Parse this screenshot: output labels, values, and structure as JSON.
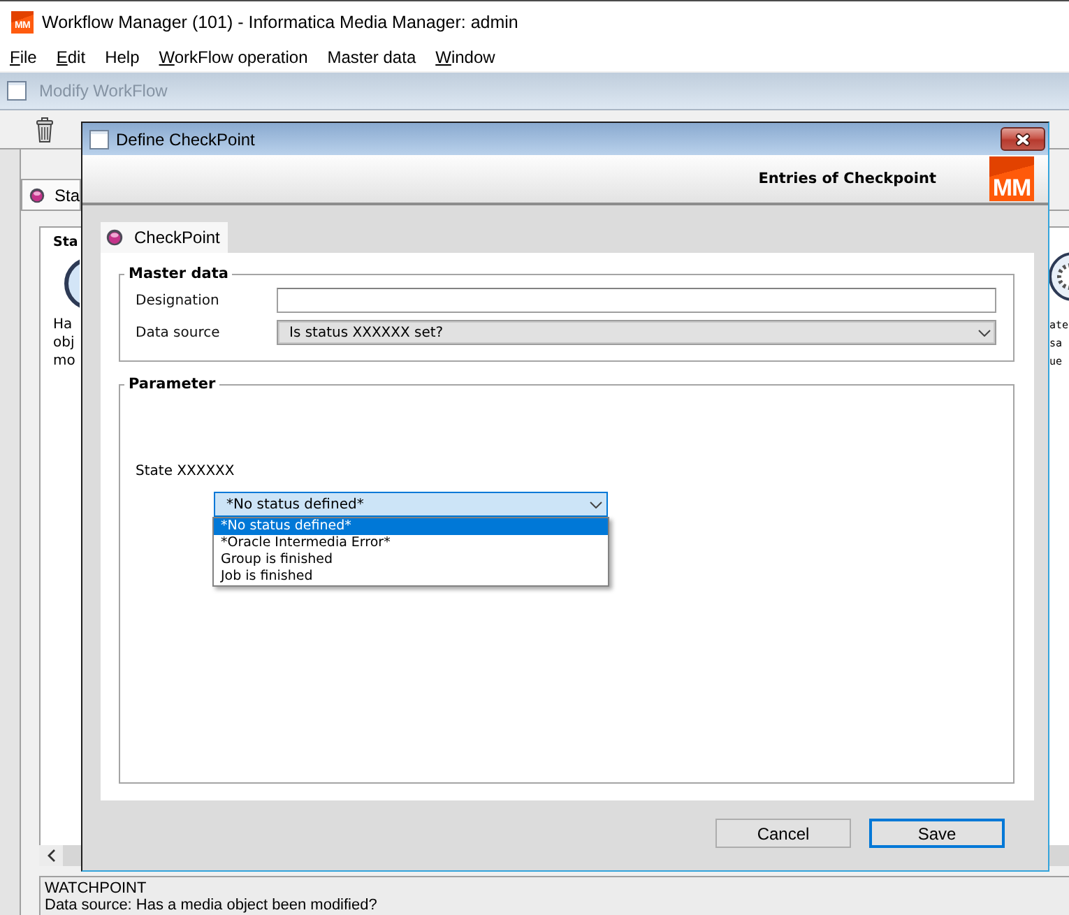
{
  "app_window": {
    "logo": "MM",
    "title": "Workflow Manager (101) - Informatica Media Manager: admin"
  },
  "menu_bar": [
    {
      "label": "File",
      "mnemonic": true
    },
    {
      "label": "Edit",
      "mnemonic": true
    },
    {
      "label": "Help",
      "mnemonic": false
    },
    {
      "label": "WorkFlow operation",
      "mnemonic": true
    },
    {
      "label": "Master data",
      "mnemonic": false
    },
    {
      "label": "Window",
      "mnemonic": true
    }
  ],
  "workflow_window": {
    "title": "Modify WorkFlow",
    "active": false,
    "tabs": [
      {
        "label": "Sta",
        "selected": true
      }
    ],
    "left_node": {
      "title": "Sta",
      "lines": [
        "Ha",
        "obj",
        "mo"
      ]
    },
    "right_node": {
      "lines": [
        "ate",
        "sa",
        "ue"
      ]
    },
    "status_panel": [
      "WATCHPOINT",
      "Data source: Has a media object been modified?"
    ]
  },
  "dialog": {
    "title": "Define CheckPoint",
    "header": "Entries of Checkpoint",
    "logo": "MM",
    "tabs": [
      {
        "label": "CheckPoint",
        "selected": true
      }
    ],
    "master_data": {
      "title": "Master data",
      "fields": [
        {
          "kind": "text",
          "label": "Designation"
        },
        {
          "kind": "combo",
          "label": "Data source",
          "value": "Is status XXXXXX set?",
          "expanded": false
        }
      ]
    },
    "parameter": {
      "title": "Parameter",
      "label": "State XXXXXX",
      "combo": {
        "value": "*No status defined*",
        "expanded": true,
        "options": [
          {
            "label": "*No status defined*",
            "selected": true
          },
          {
            "label": "*Oracle Intermedia Error*",
            "selected": false
          },
          {
            "label": "Group is finished",
            "selected": false
          },
          {
            "label": "Job is finished",
            "selected": false
          }
        ]
      }
    },
    "buttons": [
      {
        "label": "Cancel",
        "default": false
      },
      {
        "label": "Save",
        "default": true
      }
    ]
  }
}
